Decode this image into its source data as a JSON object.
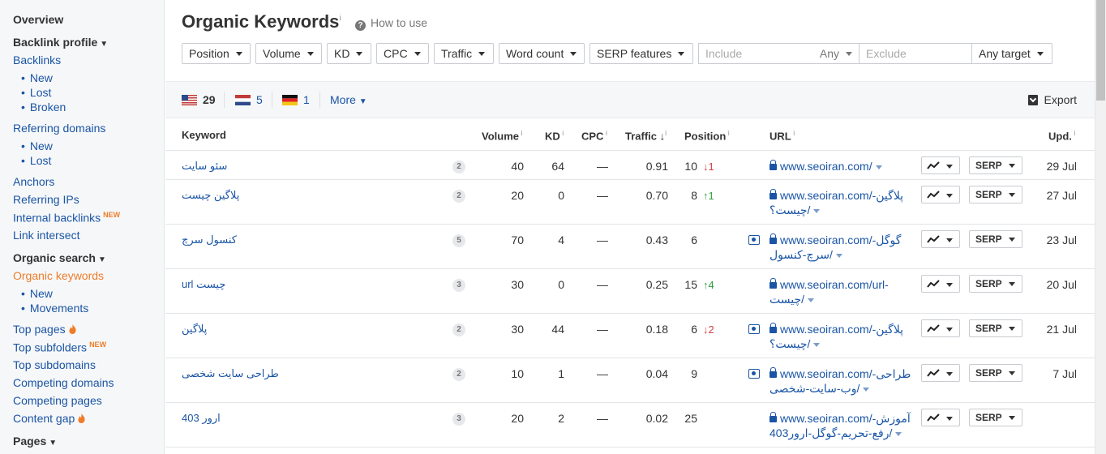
{
  "sidebar": {
    "overview": "Overview",
    "backlink_profile": "Backlink profile",
    "backlinks": "Backlinks",
    "backlinks_sub": [
      "New",
      "Lost",
      "Broken"
    ],
    "referring_domains": "Referring domains",
    "referring_sub": [
      "New",
      "Lost"
    ],
    "anchors": "Anchors",
    "referring_ips": "Referring IPs",
    "internal_backlinks": "Internal backlinks",
    "new_badge": "NEW",
    "link_intersect": "Link intersect",
    "organic_search": "Organic search",
    "organic_keywords": "Organic keywords",
    "organic_sub": [
      "New",
      "Movements"
    ],
    "top_pages": "Top pages",
    "top_subfolders": "Top subfolders",
    "top_subdomains": "Top subdomains",
    "competing_domains": "Competing domains",
    "competing_pages": "Competing pages",
    "content_gap": "Content gap",
    "pages": "Pages"
  },
  "header": {
    "title": "Organic Keywords",
    "info": "i",
    "how_to_use": "How to use"
  },
  "filters": {
    "position": "Position",
    "volume": "Volume",
    "kd": "KD",
    "cpc": "CPC",
    "traffic": "Traffic",
    "word_count": "Word count",
    "serp_features": "SERP features",
    "include_placeholder": "Include",
    "any": "Any",
    "exclude_placeholder": "Exclude",
    "any_target": "Any target"
  },
  "countries": [
    {
      "code": "us",
      "count": "29"
    },
    {
      "code": "nl",
      "count": "5"
    },
    {
      "code": "de",
      "count": "1"
    }
  ],
  "more_label": "More",
  "export_label": "Export",
  "columns": {
    "keyword": "Keyword",
    "volume": "Volume",
    "kd": "KD",
    "cpc": "CPC",
    "traffic": "Traffic",
    "position": "Position",
    "url": "URL",
    "upd": "Upd."
  },
  "rows": [
    {
      "keyword": "سئو سایت",
      "words": "2",
      "volume": "40",
      "kd": "64",
      "cpc": "—",
      "traffic": "0.91",
      "position": "10",
      "change": "↓1",
      "dir": "down",
      "serp_feature": false,
      "url1": "www.seoiran.com/",
      "url2": "",
      "upd": "29 Jul"
    },
    {
      "keyword": "پلاگین چیست",
      "words": "2",
      "volume": "20",
      "kd": "0",
      "cpc": "—",
      "traffic": "0.70",
      "position": "8",
      "change": "↑1",
      "dir": "up",
      "serp_feature": false,
      "url1": "www.seoiran.com/-پلاگین",
      "url2": "چیست؟/",
      "upd": "27 Jul"
    },
    {
      "keyword": "کنسول سرچ",
      "words": "5",
      "volume": "70",
      "kd": "4",
      "cpc": "—",
      "traffic": "0.43",
      "position": "6",
      "change": "",
      "dir": "",
      "serp_feature": true,
      "url1": "www.seoiran.com/-گوگل",
      "url2": "سرچ-کنسول/",
      "upd": "23 Jul"
    },
    {
      "keyword": "url چیست",
      "words": "3",
      "volume": "30",
      "kd": "0",
      "cpc": "—",
      "traffic": "0.25",
      "position": "15",
      "change": "↑4",
      "dir": "up",
      "serp_feature": false,
      "url1": "www.seoiran.com/url-",
      "url2": "چیست/",
      "upd": "20 Jul"
    },
    {
      "keyword": "پلاگین",
      "words": "2",
      "volume": "30",
      "kd": "44",
      "cpc": "—",
      "traffic": "0.18",
      "position": "6",
      "change": "↓2",
      "dir": "down",
      "serp_feature": true,
      "url1": "www.seoiran.com/-پلاگین",
      "url2": "چیست؟/",
      "upd": "21 Jul"
    },
    {
      "keyword": "طراحی سایت شخصی",
      "words": "2",
      "volume": "10",
      "kd": "1",
      "cpc": "—",
      "traffic": "0.04",
      "position": "9",
      "change": "",
      "dir": "",
      "serp_feature": true,
      "url1": "www.seoiran.com/-طراحی",
      "url2": "وب-سایت-شخصی/",
      "upd": "7 Jul"
    },
    {
      "keyword": "ارور 403",
      "words": "3",
      "volume": "20",
      "kd": "2",
      "cpc": "—",
      "traffic": "0.02",
      "position": "25",
      "change": "",
      "dir": "",
      "serp_feature": false,
      "url1": "www.seoiran.com/-آموزش",
      "url2": "رفع-تحریم-گوگل-ارور403/",
      "upd": ""
    }
  ],
  "serp_label": "SERP"
}
